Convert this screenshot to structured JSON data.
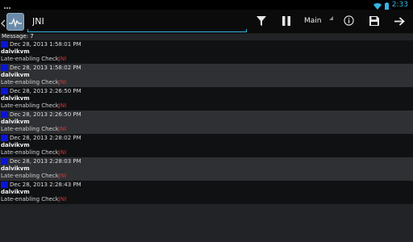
{
  "status_bar": {
    "time": "2:33"
  },
  "toolbar": {
    "filter_value": "JNI",
    "buffer_selected": "Main"
  },
  "log": {
    "message_count_label": "Message: 7",
    "entries": [
      {
        "timestamp": "Dec 28, 2013 1:58:01 PM",
        "tag": "dalvikvm",
        "message": "Late-enabling Check",
        "highlight": "JNI"
      },
      {
        "timestamp": "Dec 28, 2013 1:58:02 PM",
        "tag": "dalvikvm",
        "message": "Late-enabling Check",
        "highlight": "JNI"
      },
      {
        "timestamp": "Dec 28, 2013 2:26:50 PM",
        "tag": "dalvikvm",
        "message": "Late-enabling Check",
        "highlight": "JNI"
      },
      {
        "timestamp": "Dec 28, 2013 2:26:50 PM",
        "tag": "dalvikvm",
        "message": "Late-enabling Check",
        "highlight": "JNI"
      },
      {
        "timestamp": "Dec 28, 2013 2:28:02 PM",
        "tag": "dalvikvm",
        "message": "Late-enabling Check",
        "highlight": "JNI"
      },
      {
        "timestamp": "Dec 28, 2013 2:28:03 PM",
        "tag": "dalvikvm",
        "message": "Late-enabling Check",
        "highlight": "JNI"
      },
      {
        "timestamp": "Dec 28, 2013 2:28:43 PM",
        "tag": "dalvikvm",
        "message": "Late-enabling Check",
        "highlight": "JNI"
      }
    ]
  },
  "colors": {
    "accent": "#33b5e5",
    "level_marker": "#0a14d6",
    "highlight": "#e03030"
  },
  "icons": {
    "status_left": "grid-icon",
    "status_right": [
      "wifi-icon",
      "battery-icon"
    ],
    "toolbar": [
      "chevron-left-icon",
      "app-logo-icon",
      "filter-icon",
      "pause-icon",
      "info-icon",
      "save-icon",
      "arrow-right-icon"
    ]
  }
}
